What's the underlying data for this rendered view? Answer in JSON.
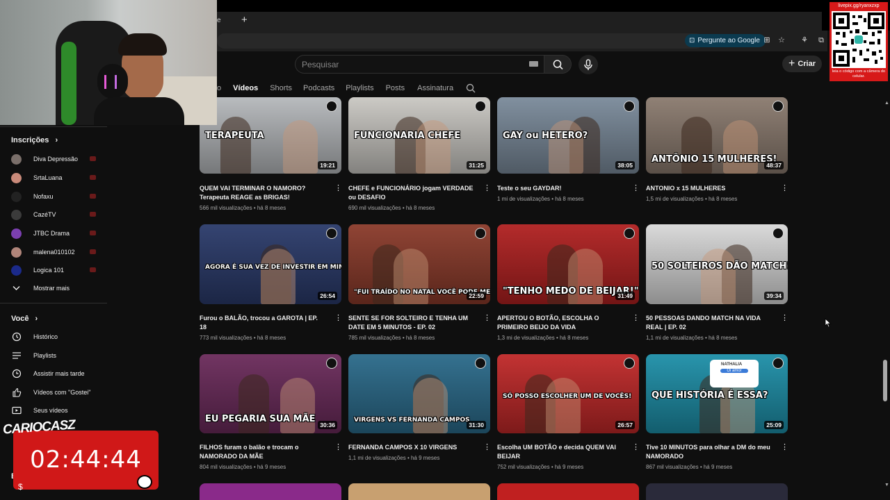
{
  "browser": {
    "new_tab_symbol": "+",
    "tab_edge_text": "e",
    "ask_google": "Pergunte ao Google"
  },
  "header": {
    "search_placeholder": "Pesquisar",
    "create_label": "Criar"
  },
  "channel_tabs": {
    "partial": "o",
    "items": [
      "Vídeos",
      "Shorts",
      "Podcasts",
      "Playlists",
      "Posts",
      "Assinatura"
    ],
    "active": "Vídeos"
  },
  "sidebar": {
    "subscriptions_title": "Inscrições",
    "subscriptions": [
      {
        "label": "Diva Depressão",
        "color": "#7a6f6a"
      },
      {
        "label": "SrtaLuana",
        "color": "#c98a7a"
      },
      {
        "label": "Nofaxu",
        "color": "#222222"
      },
      {
        "label": "CazéTV",
        "color": "#3b3b3b"
      },
      {
        "label": "JTBC Drama",
        "color": "#7b3fb0"
      },
      {
        "label": "malena010102",
        "color": "#b0857a"
      },
      {
        "label": "Logica 101",
        "color": "#1b2a8a"
      }
    ],
    "show_more": "Mostrar mais",
    "you_title": "Você",
    "you_items": [
      {
        "label": "Histórico",
        "icon": "history-icon"
      },
      {
        "label": "Playlists",
        "icon": "playlists-icon"
      },
      {
        "label": "Assistir mais tarde",
        "icon": "watch-later-icon"
      },
      {
        "label": "Vídeos com \"Gostei\"",
        "icon": "like-icon"
      },
      {
        "label": "Seus vídeos",
        "icon": "your-videos-icon"
      }
    ],
    "partial_bottom": "E"
  },
  "overlay": {
    "timer": "02:44:44",
    "brand": "CARIOCASZ",
    "qr_header": "livepix.gg/ryanxzxp",
    "qr_footer": "leia o código com a câmera do celular."
  },
  "videos": [
    {
      "title": "QUEM VAI TERMINAR O NAMORO? Terapeuta REAGE as BRIGAS!",
      "views": "566 mil visualizações",
      "age": "há 8 meses",
      "duration": "19:21",
      "watched": 0.0,
      "thumb_text": "TERAPEUTA",
      "bg": "#b5b8bb"
    },
    {
      "title": "CHEFE e FUNCIONÁRIO jogam VERDADE ou DESAFIO",
      "views": "690 mil visualizações",
      "age": "há 8 meses",
      "duration": "31:25",
      "watched": 0.0,
      "thumb_text": "FUNCIONARIA  CHEFE",
      "bg": "#c9c7c2"
    },
    {
      "title": "Teste o seu GAYDAR!",
      "views": "1 mi de visualizações",
      "age": "há 8 meses",
      "duration": "38:05",
      "watched": 0.0,
      "thumb_text": "GAY ou HETERO?",
      "bg": "#7a8a9a"
    },
    {
      "title": "ANTONIO x 15 MULHERES",
      "views": "1,5 mi de visualizações",
      "age": "há 8 meses",
      "duration": "48:37",
      "watched": 0.0,
      "thumb_text": "ANTÔNIO 15 MULHERES!",
      "bg": "#8a7a6e"
    },
    {
      "title": "Furou o BALÃO, trocou a GAROTA | EP. 18",
      "views": "773 mil visualizações",
      "age": "há 8 meses",
      "duration": "26:54",
      "watched": 0.0,
      "thumb_text": "AGORA É SUA VEZ DE INVESTIR EM MIM",
      "bg": "#2a3a6a"
    },
    {
      "title": "SENTE SE FOR SOLTEIRO E TENHA UM DATE EM 5 MINUTOS - EP. 02",
      "views": "785 mil visualizações",
      "age": "há 8 meses",
      "duration": "22:59",
      "watched": 0.0,
      "thumb_text": "\"FUI TRAÍDO NO NATAL VOCÊ PODE ME SALVAR\"",
      "bg": "#8a3a2a"
    },
    {
      "title": "APERTOU O BOTÃO, ESCOLHA O PRIMEIRO BEIJO DA VIDA",
      "views": "1,3 mi de visualizações",
      "age": "há 8 meses",
      "duration": "31:49",
      "watched": 0.0,
      "thumb_text": "\"TENHO MEDO DE BEIJAR!\"",
      "bg": "#b02020"
    },
    {
      "title": "50 PESSOAS DANDO MATCH NA VIDA REAL | EP. 02",
      "views": "1,1 mi de visualizações",
      "age": "há 8 meses",
      "duration": "39:34",
      "watched": 0.0,
      "thumb_text": "50 SOLTEIROS DÃO MATCH!",
      "bg": "#d8d8d8"
    },
    {
      "title": "FILHOS furam o balão e trocam o NAMORADO DA MÃE",
      "views": "804 mil visualizações",
      "age": "há 9 meses",
      "duration": "30:36",
      "watched": 0.0,
      "thumb_text": "EU PEGARIA SUA MÃE",
      "bg": "#6a2a5a"
    },
    {
      "title": "FERNANDA CAMPOS X 10 VIRGENS",
      "views": "1,1 mi de visualizações",
      "age": "há 9 meses",
      "duration": "31:30",
      "watched": 0.0,
      "thumb_text": "VIRGENS VS FERNANDA CAMPOS",
      "bg": "#2a6a8a"
    },
    {
      "title": "Escolha UM BOTÃO e decida QUEM VAI BEIJAR",
      "views": "752 mil visualizações",
      "age": "há 9 meses",
      "duration": "26:57",
      "watched": 0.0,
      "thumb_text": "SÓ POSSO ESCOLHER UM DE VOCÊS!",
      "bg": "#c02828"
    },
    {
      "title": "Tive 10 MINUTOS para olhar a DM do meu NAMORADO",
      "views": "867 mil visualizações",
      "age": "há 9 meses",
      "duration": "25:09",
      "watched": 0.0,
      "thumb_text": "QUE HISTÓRIA É ESSA?",
      "bg": "#1d8fa8",
      "dm_name": "NATHALIA",
      "dm_msg": "Oi amor"
    }
  ]
}
